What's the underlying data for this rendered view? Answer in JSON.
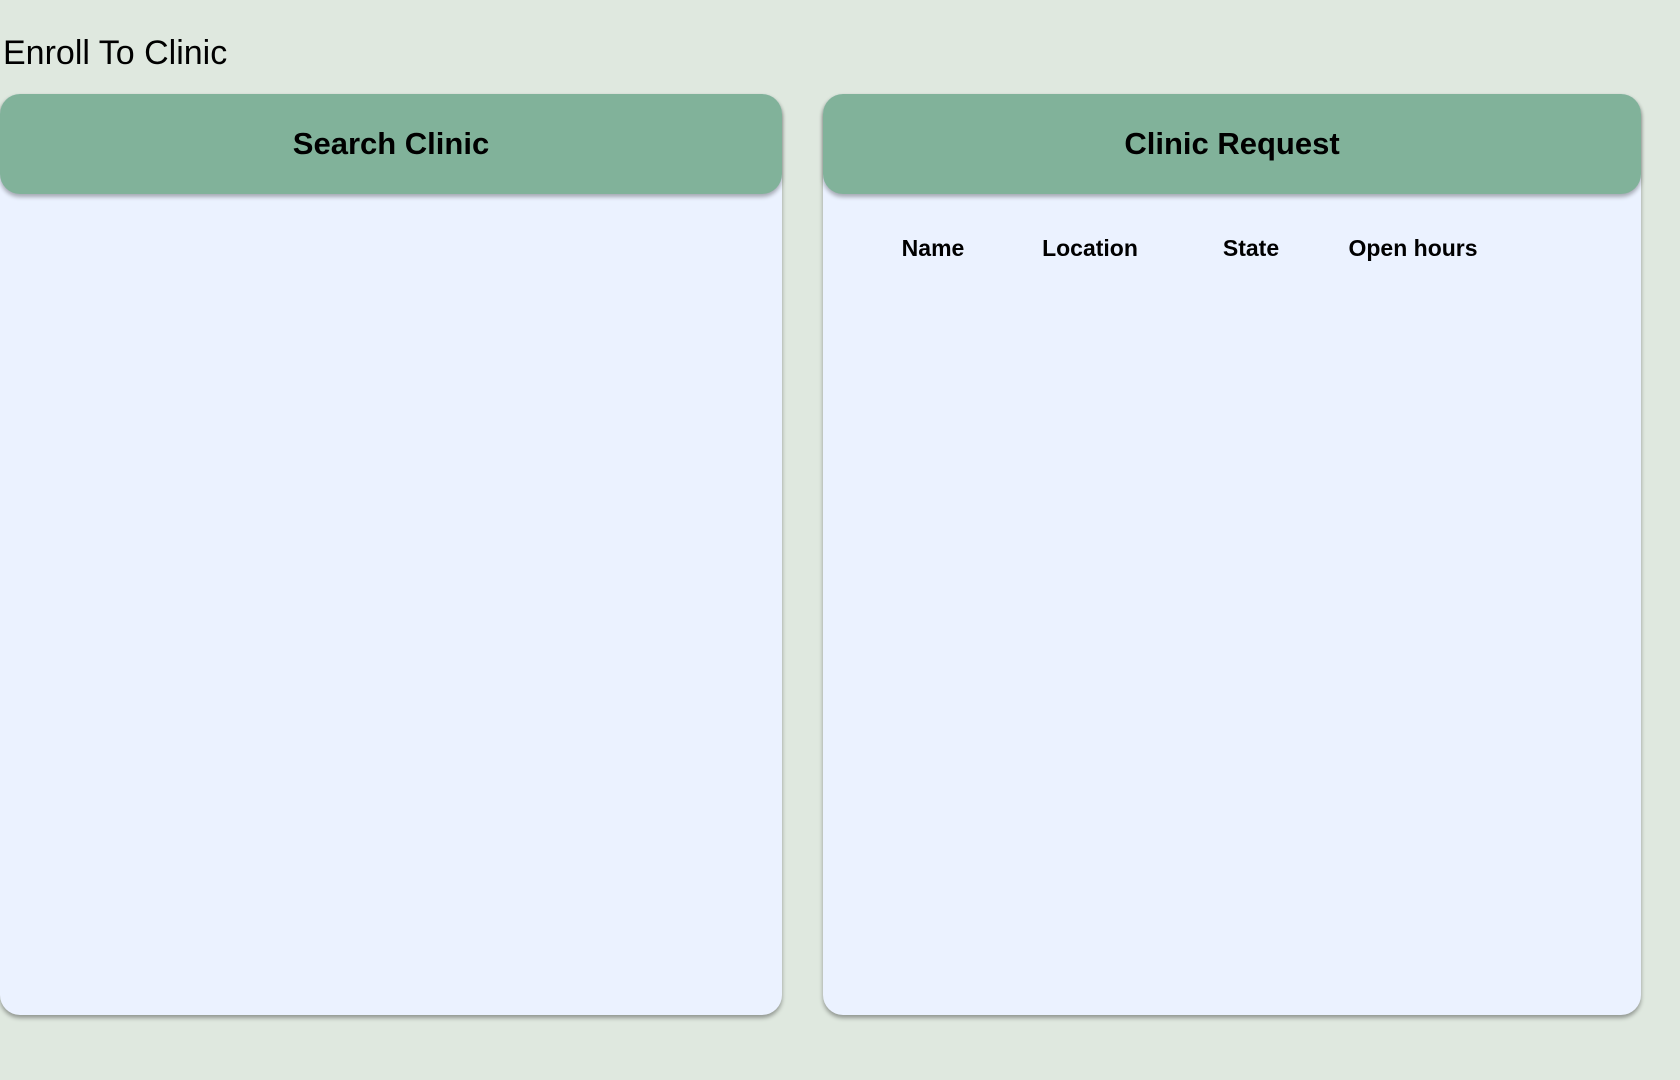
{
  "page": {
    "title": "Enroll To Clinic"
  },
  "search_panel": {
    "title": "Search Clinic"
  },
  "request_panel": {
    "title": "Clinic Request",
    "columns": [
      "Name",
      "Location",
      "State",
      "Open hours"
    ]
  },
  "colors": {
    "background": "#dfe8df",
    "header": "#81b29a",
    "panel": "#ebf2ff"
  }
}
